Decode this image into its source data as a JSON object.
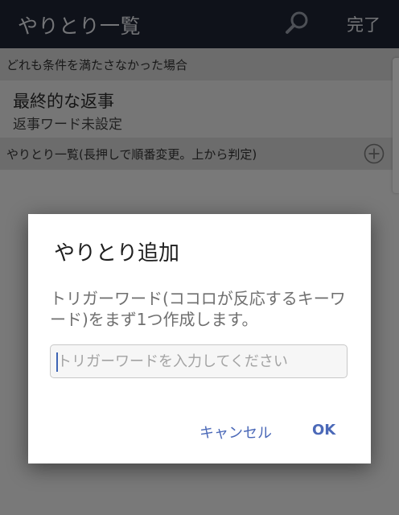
{
  "topbar": {
    "title": "やりとり一覧",
    "done_label": "完了",
    "search_icon": "search-icon"
  },
  "fallback_section": {
    "header": "どれも条件を満たさなかった場合"
  },
  "final_reply": {
    "title": "最終的な返事",
    "subtitle": "返事ワード未設定"
  },
  "list_section": {
    "header": "やりとり一覧(長押しで順番変更。上から判定)",
    "add_icon": "plus-circle-icon"
  },
  "dialog": {
    "title": "やりとり追加",
    "message": "トリガーワード(ココロが反応するキーワード)をまず1つ作成します。",
    "input": {
      "value": "",
      "placeholder": "トリガーワードを入力してください"
    },
    "cancel_label": "キャンセル",
    "ok_label": "OK"
  },
  "colors": {
    "topbar": "#1f2434",
    "accent": "#4b69b8",
    "section_bg": "#d9d9d9"
  }
}
